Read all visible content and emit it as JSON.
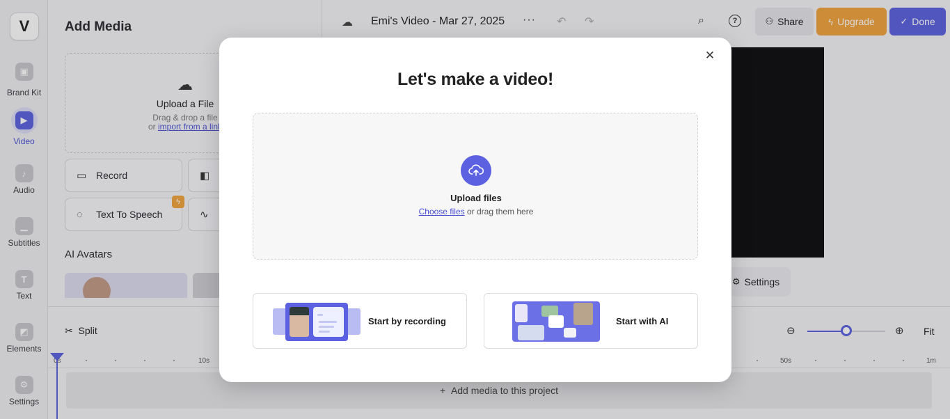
{
  "rail": {
    "logo": "V",
    "items": [
      {
        "label": "Brand Kit",
        "icon": "brand-kit-icon"
      },
      {
        "label": "Video",
        "icon": "video-camera-icon",
        "active": true
      },
      {
        "label": "Audio",
        "icon": "music-note-icon"
      },
      {
        "label": "Subtitles",
        "icon": "subtitles-icon"
      },
      {
        "label": "Text",
        "icon": "text-icon"
      },
      {
        "label": "Elements",
        "icon": "elements-icon"
      },
      {
        "label": "Settings",
        "icon": "settings-icon"
      }
    ]
  },
  "panel": {
    "title": "Add Media",
    "dropzone": {
      "title": "Upload a File",
      "line1": "Drag & drop a file",
      "or": "or",
      "link": "import from a link"
    },
    "tools": {
      "record": "Record",
      "text_to_speech": "Text To Speech"
    },
    "section_avatars": "AI Avatars"
  },
  "topbar": {
    "project_title": "Emi's Video - Mar 27, 2025",
    "more": "···",
    "share": "Share",
    "upgrade": "Upgrade",
    "done": "Done"
  },
  "preview": {
    "settings": "Settings"
  },
  "timeline": {
    "split": "Split",
    "fit": "Fit",
    "zoom_level": 0.5,
    "ticks": [
      "0s",
      "10s",
      "50s",
      "1m"
    ],
    "add_media": "Add media to this project"
  },
  "modal": {
    "title": "Let's make a video!",
    "upload_title": "Upload files",
    "choose_files": "Choose files",
    "drag_text": "or drag them here",
    "option_record": "Start by recording",
    "option_ai": "Start with AI"
  },
  "colors": {
    "accent": "#5b61e0",
    "upgrade": "#f2a33a"
  }
}
